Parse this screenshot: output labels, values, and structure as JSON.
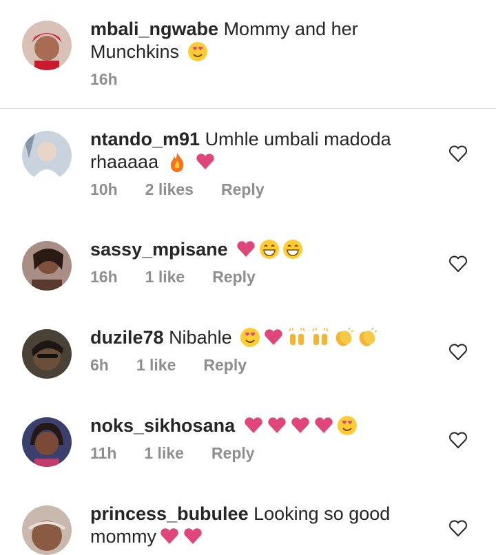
{
  "comments": [
    {
      "username": "mbali_ngwabe",
      "text": "Mommy and her Munchkins",
      "emojis": [
        "heart-eyes"
      ],
      "time": "16h",
      "likes": "",
      "reply": ""
    },
    {
      "username": "ntando_m91",
      "text": "Umhle umbali madoda rhaaaaa",
      "emojis": [
        "fire",
        "pink-heart"
      ],
      "time": "10h",
      "likes": "2 likes",
      "reply": "Reply"
    },
    {
      "username": "sassy_mpisane",
      "text": "",
      "emojis": [
        "pink-heart",
        "grin",
        "grin"
      ],
      "time": "16h",
      "likes": "1 like",
      "reply": "Reply"
    },
    {
      "username": "duzile78",
      "text": "Nibahle",
      "emojis": [
        "heart-eyes",
        "pink-heart",
        "raised-hands",
        "raised-hands",
        "clap",
        "clap"
      ],
      "time": "6h",
      "likes": "1 like",
      "reply": "Reply"
    },
    {
      "username": "noks_sikhosana",
      "text": "",
      "emojis": [
        "pink-heart",
        "pink-heart",
        "pink-heart",
        "pink-heart",
        "heart-eyes"
      ],
      "time": "11h",
      "likes": "1 like",
      "reply": "Reply"
    },
    {
      "username": "princess_bubulee",
      "text": "Looking so good mommy",
      "emojis": [
        "pink-heart",
        "pink-heart"
      ],
      "time": "",
      "likes": "",
      "reply": ""
    }
  ],
  "icons": {
    "like": "heart-outline-icon"
  },
  "colors": {
    "text": "#262626",
    "meta": "#8e8e8e",
    "heart": "#e0457b"
  }
}
